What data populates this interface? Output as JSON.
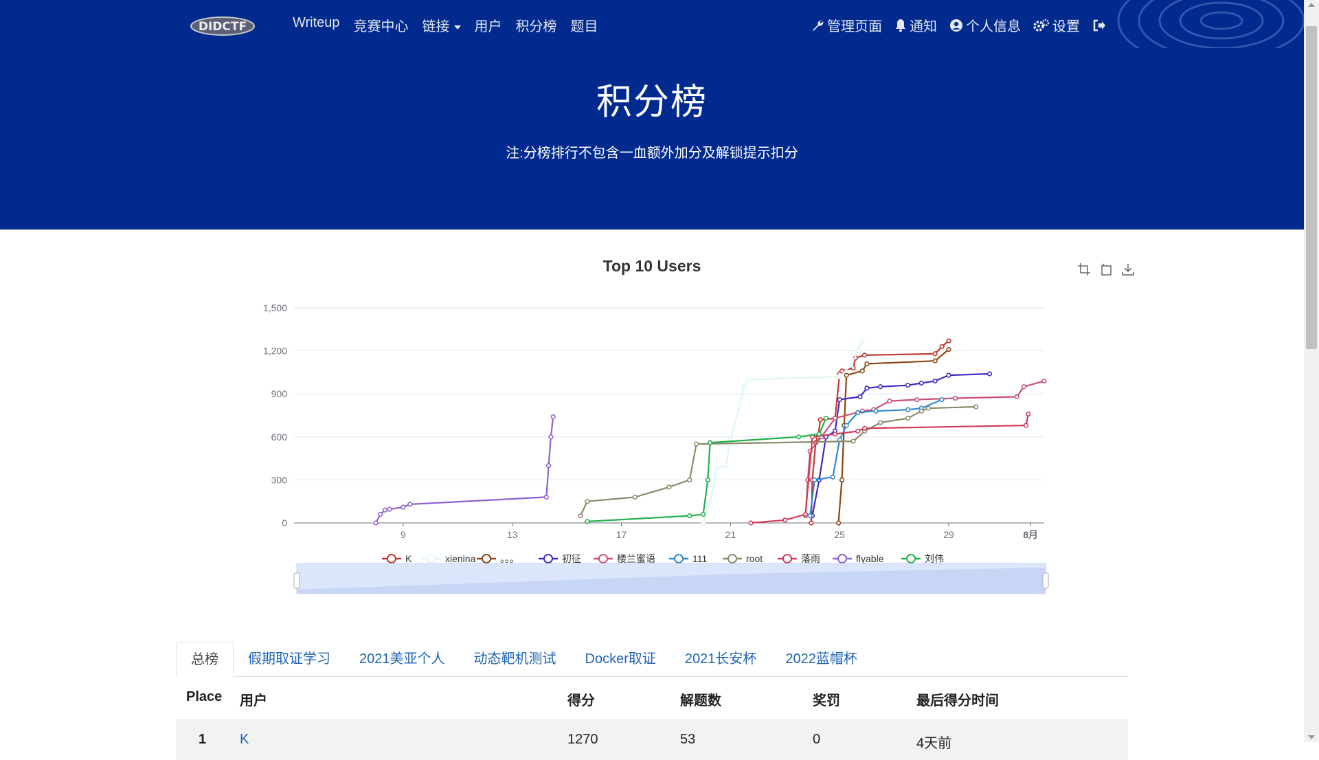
{
  "nav": {
    "logo_text": "DIDCTF",
    "left_items": [
      "Writeup",
      "竞赛中心",
      "链接",
      "用户",
      "积分榜",
      "题目"
    ],
    "right_items": [
      "管理页面",
      "通知",
      "个人信息",
      "设置"
    ]
  },
  "jumbotron": {
    "title": "积分榜",
    "note": "注:分榜排行不包含一血额外加分及解锁提示扣分"
  },
  "chart_data": {
    "type": "line",
    "title": "Top 10 Users",
    "xlabel": "",
    "ylabel": "",
    "x_axis_type": "time",
    "x_range": [
      "2021-07-05",
      "2021-08-01"
    ],
    "x_tick_labels": [
      {
        "date": "2021-07-09",
        "label": "9"
      },
      {
        "date": "2021-07-13",
        "label": "13"
      },
      {
        "date": "2021-07-17",
        "label": "17"
      },
      {
        "date": "2021-07-21",
        "label": "21"
      },
      {
        "date": "2021-07-25",
        "label": "25"
      },
      {
        "date": "2021-07-29",
        "label": "29"
      },
      {
        "date": "2021-08-01",
        "label": "8月"
      }
    ],
    "ylim": [
      0,
      1500
    ],
    "y_ticks": [
      0,
      300,
      600,
      900,
      1200,
      1500
    ],
    "y_tick_labels": [
      "0",
      "300",
      "600",
      "900",
      "1,200",
      "1,500"
    ],
    "grid": "horizontal",
    "legend_position": "bottom",
    "series": [
      {
        "name": "K",
        "color": "#c23531",
        "points": [
          [
            "2021-07-23T23:00",
            0
          ],
          [
            "2021-07-24T00:00",
            300
          ],
          [
            "2021-07-24T03:00",
            560
          ],
          [
            "2021-07-24T05:00",
            600
          ],
          [
            "2021-07-24T07:00",
            720
          ],
          [
            "2021-07-24T20:00",
            730
          ],
          [
            "2021-07-25T00:00",
            1040
          ],
          [
            "2021-07-25T02:00",
            1060
          ],
          [
            "2021-07-25T12:00",
            1080
          ],
          [
            "2021-07-25T14:00",
            1150
          ],
          [
            "2021-07-25T22:00",
            1170
          ],
          [
            "2021-07-28T12:00",
            1180
          ],
          [
            "2021-07-28T18:00",
            1230
          ],
          [
            "2021-07-29T00:00",
            1270
          ]
        ]
      },
      {
        "name": "xienina",
        "color": "#e0f7f0",
        "points": [
          [
            "2021-07-20T00:00",
            0
          ],
          [
            "2021-07-20T06:00",
            150
          ],
          [
            "2021-07-20T12:00",
            380
          ],
          [
            "2021-07-20T20:00",
            400
          ],
          [
            "2021-07-21T00:00",
            580
          ],
          [
            "2021-07-21T08:00",
            820
          ],
          [
            "2021-07-21T12:00",
            950
          ],
          [
            "2021-07-21T16:00",
            1000
          ],
          [
            "2021-07-25T00:00",
            1020
          ],
          [
            "2021-07-25T10:00",
            1100
          ],
          [
            "2021-07-25T16:00",
            1200
          ],
          [
            "2021-07-25T20:00",
            1270
          ]
        ]
      },
      {
        "name": "。。。",
        "color": "#8b4513",
        "points": [
          [
            "2021-07-24T23:00",
            0
          ],
          [
            "2021-07-25T02:00",
            300
          ],
          [
            "2021-07-25T04:00",
            680
          ],
          [
            "2021-07-25T06:00",
            1030
          ],
          [
            "2021-07-25T20:00",
            1060
          ],
          [
            "2021-07-26T00:00",
            1110
          ],
          [
            "2021-07-28T12:00",
            1130
          ],
          [
            "2021-07-29T00:00",
            1210
          ]
        ]
      },
      {
        "name": "初征",
        "color": "#3e2ac4",
        "points": [
          [
            "2021-07-24T00:00",
            50
          ],
          [
            "2021-07-24T06:00",
            300
          ],
          [
            "2021-07-24T12:00",
            600
          ],
          [
            "2021-07-24T20:00",
            640
          ],
          [
            "2021-07-25T00:00",
            860
          ],
          [
            "2021-07-25T18:00",
            880
          ],
          [
            "2021-07-26T00:00",
            940
          ],
          [
            "2021-07-26T12:00",
            950
          ],
          [
            "2021-07-27T12:00",
            960
          ],
          [
            "2021-07-28T00:00",
            975
          ],
          [
            "2021-07-28T12:00",
            990
          ],
          [
            "2021-07-29T00:00",
            1030
          ],
          [
            "2021-07-30T12:00",
            1040
          ]
        ]
      },
      {
        "name": "楼兰蜜语",
        "color": "#c94f7c",
        "points": [
          [
            "2021-07-23T18:00",
            50
          ],
          [
            "2021-07-23T20:00",
            300
          ],
          [
            "2021-07-23T22:00",
            500
          ],
          [
            "2021-07-24T08:00",
            600
          ],
          [
            "2021-07-24T20:00",
            730
          ],
          [
            "2021-07-25T20:00",
            780
          ],
          [
            "2021-07-26T06:00",
            790
          ],
          [
            "2021-07-26T20:00",
            850
          ],
          [
            "2021-07-27T20:00",
            860
          ],
          [
            "2021-07-29T06:00",
            870
          ],
          [
            "2021-07-31T12:00",
            880
          ],
          [
            "2021-07-31T18:00",
            950
          ],
          [
            "2021-08-01T12:00",
            990
          ]
        ]
      },
      {
        "name": "111",
        "color": "#2e8bd0",
        "points": [
          [
            "2021-07-23T22:00",
            50
          ],
          [
            "2021-07-24T02:00",
            300
          ],
          [
            "2021-07-24T18:00",
            320
          ],
          [
            "2021-07-25T00:00",
            580
          ],
          [
            "2021-07-25T06:00",
            680
          ],
          [
            "2021-07-25T16:00",
            770
          ],
          [
            "2021-07-26T08:00",
            780
          ],
          [
            "2021-07-27T12:00",
            790
          ],
          [
            "2021-07-28T00:00",
            800
          ],
          [
            "2021-07-28T18:00",
            860
          ]
        ]
      },
      {
        "name": "root",
        "color": "#8b8b6a",
        "points": [
          [
            "2021-07-15T12:00",
            50
          ],
          [
            "2021-07-15T18:00",
            150
          ],
          [
            "2021-07-17T12:00",
            180
          ],
          [
            "2021-07-18T18:00",
            250
          ],
          [
            "2021-07-19T12:00",
            300
          ],
          [
            "2021-07-19T18:00",
            550
          ],
          [
            "2021-07-25T12:00",
            570
          ],
          [
            "2021-07-25T22:00",
            640
          ],
          [
            "2021-07-26T12:00",
            700
          ],
          [
            "2021-07-27T12:00",
            730
          ],
          [
            "2021-07-28T00:00",
            780
          ],
          [
            "2021-07-28T06:00",
            800
          ],
          [
            "2021-07-30T00:00",
            810
          ]
        ]
      },
      {
        "name": "落雨",
        "color": "#d13a5a",
        "points": [
          [
            "2021-07-21T18:00",
            0
          ],
          [
            "2021-07-23T00:00",
            20
          ],
          [
            "2021-07-23T18:00",
            60
          ],
          [
            "2021-07-24T00:00",
            600
          ],
          [
            "2021-07-24T20:00",
            620
          ],
          [
            "2021-07-25T16:00",
            640
          ],
          [
            "2021-07-25T22:00",
            660
          ],
          [
            "2021-07-31T20:00",
            680
          ],
          [
            "2021-07-31T22:00",
            760
          ]
        ]
      },
      {
        "name": "flyable",
        "color": "#9060d0",
        "points": [
          [
            "2021-07-08T00:00",
            0
          ],
          [
            "2021-07-08T04:00",
            60
          ],
          [
            "2021-07-08T08:00",
            90
          ],
          [
            "2021-07-08T12:00",
            95
          ],
          [
            "2021-07-09T00:00",
            110
          ],
          [
            "2021-07-09T06:00",
            130
          ],
          [
            "2021-07-14T06:00",
            180
          ],
          [
            "2021-07-14T08:00",
            400
          ],
          [
            "2021-07-14T10:00",
            600
          ],
          [
            "2021-07-14T12:00",
            740
          ]
        ]
      },
      {
        "name": "刘伟",
        "color": "#22b14c",
        "points": [
          [
            "2021-07-15T18:00",
            10
          ],
          [
            "2021-07-19T12:00",
            50
          ],
          [
            "2021-07-20T00:00",
            60
          ],
          [
            "2021-07-20T04:00",
            300
          ],
          [
            "2021-07-20T06:00",
            560
          ],
          [
            "2021-07-23T12:00",
            600
          ],
          [
            "2021-07-24T06:00",
            620
          ],
          [
            "2021-07-24T12:00",
            730
          ]
        ]
      }
    ]
  },
  "tabs": [
    "总榜",
    "假期取证学习",
    "2021美亚个人",
    "动态靶机测试",
    "Docker取证",
    "2021长安杯",
    "2022蓝帽杯"
  ],
  "table": {
    "headers": [
      "Place",
      "用户",
      "得分",
      "解题数",
      "奖罚",
      "最后得分时间"
    ],
    "rows": [
      {
        "place": "1",
        "user": "K",
        "score": "1270",
        "solves": "53",
        "penalty": "0",
        "last": "4天前"
      }
    ]
  }
}
